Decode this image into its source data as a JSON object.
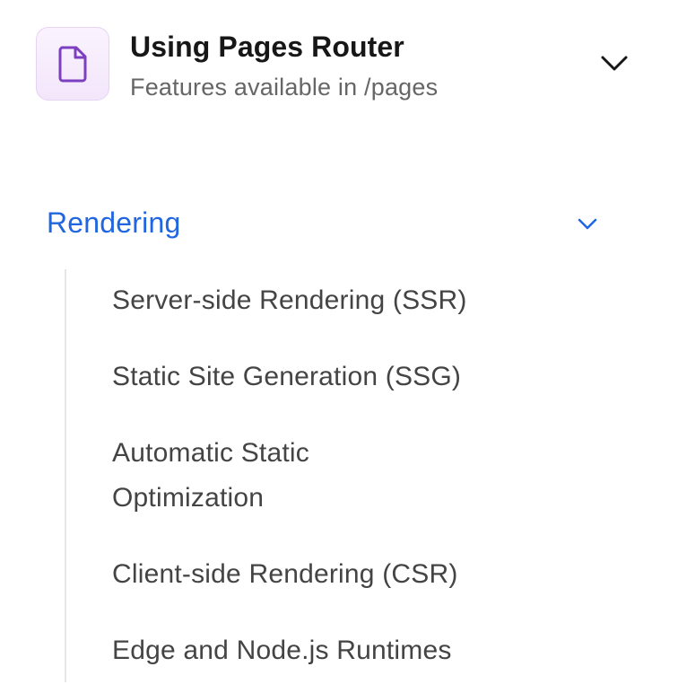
{
  "router_switcher": {
    "title": "Using Pages Router",
    "subtitle": "Features available in /pages",
    "icon": "file-icon",
    "icon_color": "#7b3fbf",
    "toggle_icon": "chevron-down-icon"
  },
  "section": {
    "title": "Rendering",
    "color": "#1f66e0",
    "toggle_icon": "chevron-down-icon",
    "items": [
      {
        "label": "Server-side Rendering (SSR)"
      },
      {
        "label": "Static Site Generation (SSG)"
      },
      {
        "label": "Automatic Static Optimization"
      },
      {
        "label": "Client-side Rendering (CSR)"
      },
      {
        "label": "Edge and Node.js Runtimes"
      }
    ]
  }
}
